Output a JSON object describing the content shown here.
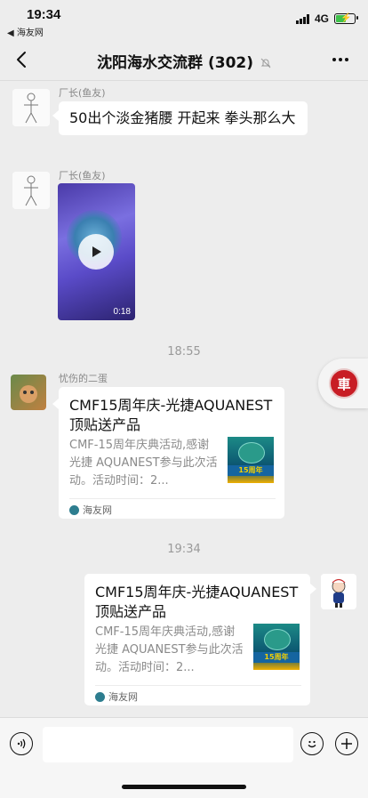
{
  "status_bar": {
    "time": "19:34",
    "back_app": "◀ 海友网",
    "network": "4G"
  },
  "nav": {
    "title": "沈阳海水交流群 (302)"
  },
  "messages": [
    {
      "sender": "厂长(鱼友)",
      "text": "50出个淡金猪腰 开起来 拳头那么大"
    },
    {
      "sender": "厂长(鱼友)",
      "video_duration": "0:18"
    }
  ],
  "time_dividers": [
    "18:55",
    "19:34"
  ],
  "link_cards": [
    {
      "sender": "忧伤的二蛋",
      "title": "CMF15周年庆-光捷AQUANEST顶贴送产品",
      "desc": "CMF-15周年庆典活动,感谢光捷 AQUANEST参与此次活动。活动时间：2...",
      "thumb_text": "15周年",
      "source": "海友网"
    },
    {
      "title": "CMF15周年庆-光捷AQUANEST顶贴送产品",
      "desc": "CMF-15周年庆典活动,感谢光捷 AQUANEST参与此次活动。活动时间：2...",
      "thumb_text": "15周年",
      "source": "海友网"
    }
  ],
  "floating_button": {
    "label": "車"
  },
  "colors": {
    "background": "#ededed",
    "bubble": "#ffffff",
    "battery": "#3ec14a",
    "float_logo": "#c81d25"
  }
}
